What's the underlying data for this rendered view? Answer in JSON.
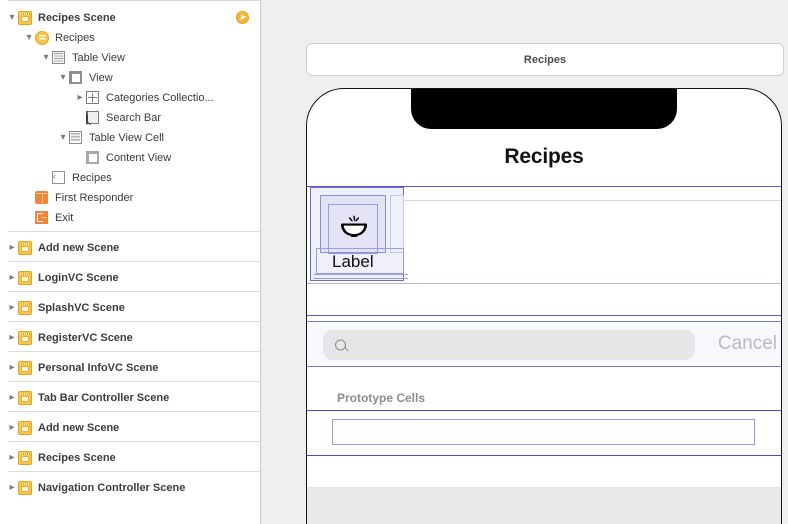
{
  "outline": {
    "entry_point_icon": "entry-point-arrow-icon",
    "items": [
      {
        "label": "Recipes Scene",
        "icon": "view-controller-scene-icon",
        "indent": 0,
        "disclosure": "down",
        "bold": true,
        "type": "scene"
      },
      {
        "label": "Recipes",
        "icon": "table-view-controller-icon",
        "indent": 1,
        "disclosure": "down",
        "bold": false,
        "type": "controller"
      },
      {
        "label": "Table View",
        "icon": "table-view-icon",
        "indent": 2,
        "disclosure": "down",
        "bold": false,
        "type": "view"
      },
      {
        "label": "View",
        "icon": "view-icon",
        "indent": 3,
        "disclosure": "down",
        "bold": false,
        "type": "view"
      },
      {
        "label": "Categories Collectio...",
        "icon": "collection-view-icon",
        "indent": 4,
        "disclosure": "right",
        "bold": false,
        "type": "view"
      },
      {
        "label": "Search Bar",
        "icon": "search-bar-icon",
        "indent": 4,
        "disclosure": "none",
        "bold": false,
        "type": "view"
      },
      {
        "label": "Table View Cell",
        "icon": "table-view-cell-icon",
        "indent": 3,
        "disclosure": "down",
        "bold": false,
        "type": "view"
      },
      {
        "label": "Content View",
        "icon": "content-view-icon",
        "indent": 4,
        "disclosure": "none",
        "bold": false,
        "type": "view"
      },
      {
        "label": "Recipes",
        "icon": "navigation-item-icon",
        "indent": 2,
        "disclosure": "none",
        "bold": false,
        "type": "nav-item"
      },
      {
        "label": "First Responder",
        "icon": "first-responder-icon",
        "indent": 1,
        "disclosure": "none",
        "bold": false,
        "type": "placeholder"
      },
      {
        "label": "Exit",
        "icon": "exit-icon",
        "indent": 1,
        "disclosure": "none",
        "bold": false,
        "type": "placeholder"
      },
      {
        "label": "Add new Scene",
        "icon": "view-controller-scene-icon",
        "indent": 0,
        "disclosure": "right",
        "bold": true,
        "type": "scene"
      },
      {
        "label": "LoginVC Scene",
        "icon": "view-controller-scene-icon",
        "indent": 0,
        "disclosure": "right",
        "bold": true,
        "type": "scene"
      },
      {
        "label": "SplashVC Scene",
        "icon": "view-controller-scene-icon",
        "indent": 0,
        "disclosure": "right",
        "bold": true,
        "type": "scene"
      },
      {
        "label": "RegisterVC Scene",
        "icon": "view-controller-scene-icon",
        "indent": 0,
        "disclosure": "right",
        "bold": true,
        "type": "scene"
      },
      {
        "label": "Personal InfoVC Scene",
        "icon": "view-controller-scene-icon",
        "indent": 0,
        "disclosure": "right",
        "bold": true,
        "type": "scene"
      },
      {
        "label": "Tab Bar Controller Scene",
        "icon": "view-controller-scene-icon",
        "indent": 0,
        "disclosure": "right",
        "bold": true,
        "type": "scene"
      },
      {
        "label": "Add new Scene",
        "icon": "view-controller-scene-icon",
        "indent": 0,
        "disclosure": "right",
        "bold": true,
        "type": "scene"
      },
      {
        "label": "Recipes Scene",
        "icon": "view-controller-scene-icon",
        "indent": 0,
        "disclosure": "right",
        "bold": true,
        "type": "scene"
      },
      {
        "label": "Navigation Controller Scene",
        "icon": "view-controller-scene-icon",
        "indent": 0,
        "disclosure": "right",
        "bold": true,
        "type": "scene"
      }
    ]
  },
  "canvas": {
    "scene_title": "Recipes",
    "device": {
      "nav_title": "Recipes",
      "collection_cell": {
        "label": "Label",
        "image_icon": "food-bowl-icon"
      },
      "search_bar": {
        "placeholder": "",
        "value": "",
        "cancel_label": "Cancel",
        "search_icon": "magnifier-icon"
      },
      "prototype_cells_header": "Prototype Cells"
    }
  },
  "colors": {
    "canvas_background": "#efefef",
    "selection_blue": "#4b4bcf",
    "guide_blue": "#8c8cdb",
    "scene_icon_yellow": "#fbc44d",
    "placeholder_orange": "#ef8536",
    "entry_arrow": "#f5b731"
  }
}
